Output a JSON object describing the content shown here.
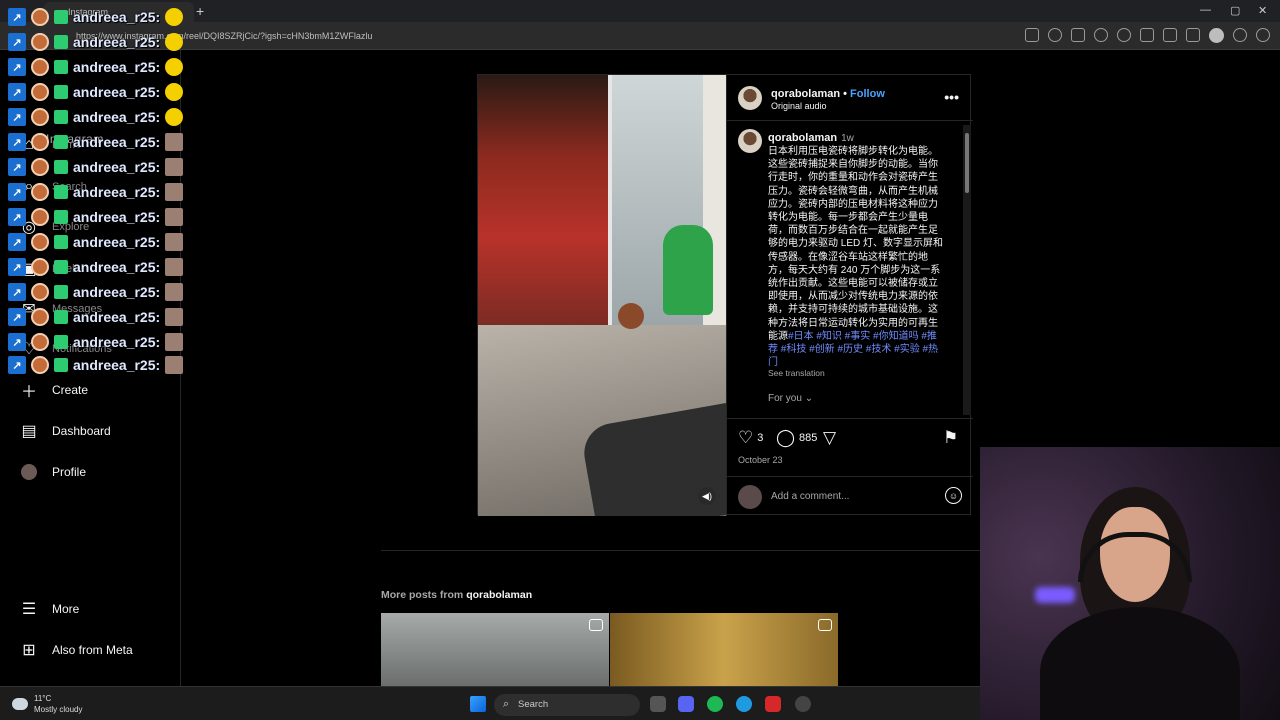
{
  "browser": {
    "tab_title": "Instagram",
    "url": "https://www.instagram.com/reel/DQI8SZRjCic/?igsh=cHN3bmM1ZWFlazlu"
  },
  "chat_overlay": {
    "username": "andreea_r25:",
    "rows": 15
  },
  "sidebar": {
    "logo": "Instagram",
    "items": [
      {
        "label": "Home",
        "icon": "home-icon"
      },
      {
        "label": "Search",
        "icon": "search-icon"
      },
      {
        "label": "Explore",
        "icon": "compass-icon"
      },
      {
        "label": "Reels",
        "icon": "reels-icon"
      },
      {
        "label": "Messages",
        "icon": "messenger-icon"
      },
      {
        "label": "Notifications",
        "icon": "heart-icon"
      },
      {
        "label": "Create",
        "icon": "plus-icon"
      },
      {
        "label": "Dashboard",
        "icon": "chart-icon"
      },
      {
        "label": "Profile",
        "icon": "avatar-icon"
      },
      {
        "label": "More",
        "icon": "hamburger-icon"
      },
      {
        "label": "Also from Meta",
        "icon": "meta-icon"
      }
    ]
  },
  "post": {
    "username": "qorabolaman",
    "follow_label": "Follow",
    "audio": "Original audio",
    "caption_user": "qorabolaman",
    "caption_time": "1w",
    "caption_text": "日本利用压电瓷砖将脚步转化为电能。这些瓷砖捕捉来自你脚步的动能。当你行走时，你的重量和动作会对瓷砖产生压力。瓷砖会轻微弯曲，从而产生机械应力。瓷砖内部的压电材料将这种应力转化为电能。每一步都会产生少量电荷，而数百万步结合在一起就能产生足够的电力来驱动 LED 灯、数字显示屏和传感器。在像涩谷车站这样繁忙的地方，每天大约有 240 万个脚步为这一系统作出贡献。这些电能可以被储存或立即使用，从而减少对传统电力来源的依赖，并支持可持续的城市基础设施。这种方法将日常运动转化为实用的可再生能源",
    "caption_tags": "#日本 #知识 #事实 #你知道吗 #推荐 #科技 #创新 #历史 #技术 #实验 #热门",
    "see_translation": "See translation",
    "for_you": "For you",
    "likes": "3",
    "comments": "885",
    "date": "October 23",
    "comment_placeholder": "Add a comment..."
  },
  "more_posts": {
    "prefix": "More posts from ",
    "user": "qorabolaman"
  },
  "taskbar": {
    "temp": "11°C",
    "weather": "Mostly cloudy",
    "search": "Search"
  },
  "colors": {
    "accent": "#4aa3ff",
    "hashtag": "#6f8cff",
    "background": "#000000"
  }
}
